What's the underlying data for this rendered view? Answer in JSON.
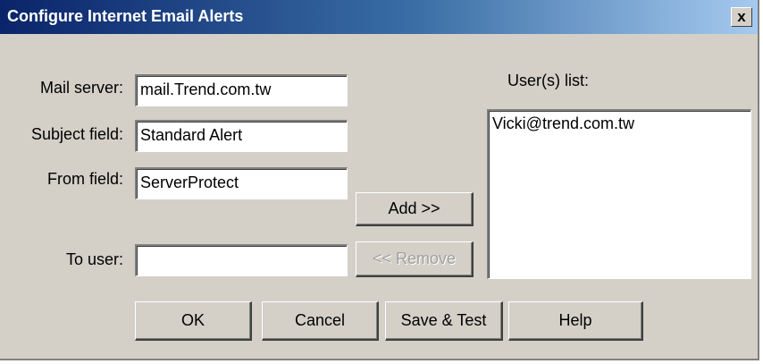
{
  "window": {
    "title": "Configure Internet Email Alerts",
    "close_glyph": "x"
  },
  "form": {
    "mail_server_label": "Mail server:",
    "mail_server_value": "mail.Trend.com.tw",
    "subject_label": "Subject field:",
    "subject_value": "Standard Alert",
    "from_label": "From field:",
    "from_value": "ServerProtect",
    "to_user_label": "To user:",
    "to_user_value": ""
  },
  "users": {
    "label": "User(s) list:",
    "items": [
      "Vicki@trend.com.tw"
    ]
  },
  "buttons": {
    "add": "Add >>",
    "remove": "<< Remove",
    "ok": "OK",
    "cancel": "Cancel",
    "save_test": "Save & Test",
    "help": "Help"
  },
  "colors": {
    "dialog_bg": "#d4d0c8",
    "titlebar_start": "#0a246a",
    "titlebar_end": "#a6caf0",
    "disabled_text": "#a0a0a0"
  }
}
